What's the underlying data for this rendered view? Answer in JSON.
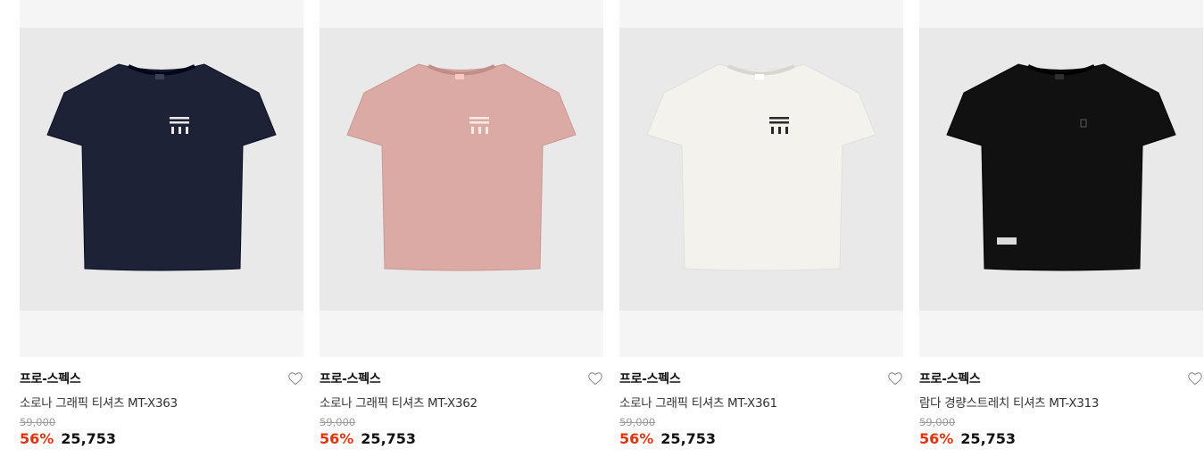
{
  "products": [
    {
      "brand": "프로-스펙스",
      "name": "소로나 그래픽 티셔츠 MT-X363",
      "original_price": "59,000",
      "discount": "56%",
      "sale_price": "25,753",
      "shirt_color": "#1d2237",
      "print_color": "#e9e9e9",
      "print": "graphic",
      "wishlist_icon": "heart-outline-icon"
    },
    {
      "brand": "프로-스펙스",
      "name": "소로나 그래픽 티셔츠 MT-X362",
      "original_price": "59,000",
      "discount": "56%",
      "sale_price": "25,753",
      "shirt_color": "#dcaaa4",
      "print_color": "#f7e9e6",
      "print": "graphic",
      "wishlist_icon": "heart-outline-icon"
    },
    {
      "brand": "프로-스펙스",
      "name": "소로나 그래픽 티셔츠 MT-X361",
      "original_price": "59,000",
      "discount": "56%",
      "sale_price": "25,753",
      "shirt_color": "#f3f2ed",
      "print_color": "#2a2a2a",
      "print": "graphic",
      "wishlist_icon": "heart-outline-icon"
    },
    {
      "brand": "프로-스펙스",
      "name": "람다 경량스트레치 티셔츠 MT-X313",
      "original_price": "59,000",
      "discount": "56%",
      "sale_price": "25,753",
      "shirt_color": "#111111",
      "print_color": "#5a5a5a",
      "print": "small-logo",
      "wishlist_icon": "heart-outline-icon"
    }
  ],
  "colors": {
    "discount": "#e2330c",
    "thumb_bg": "#f5f5f5",
    "photo_bg": "#e9e9e9"
  }
}
